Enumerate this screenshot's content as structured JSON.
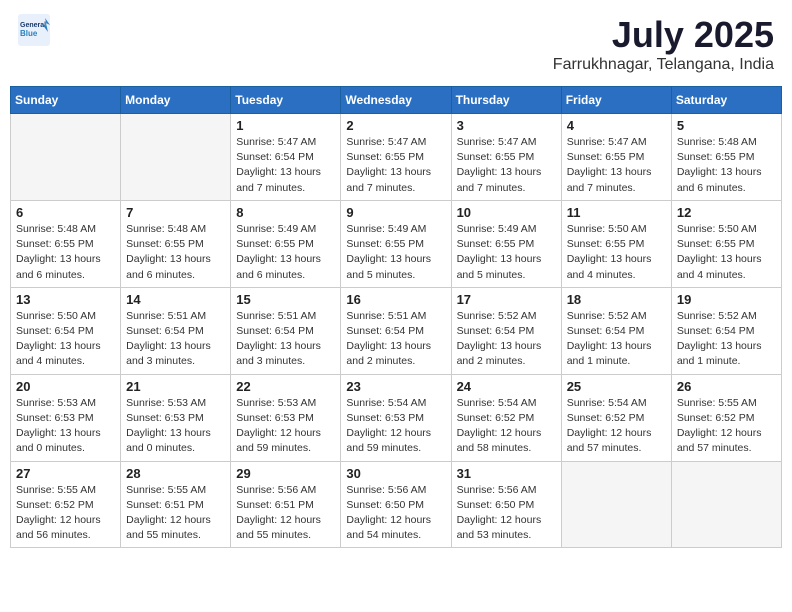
{
  "header": {
    "logo_line1": "General",
    "logo_line2": "Blue",
    "month_title": "July 2025",
    "subtitle": "Farrukhnagar, Telangana, India"
  },
  "weekdays": [
    "Sunday",
    "Monday",
    "Tuesday",
    "Wednesday",
    "Thursday",
    "Friday",
    "Saturday"
  ],
  "weeks": [
    [
      {
        "day": "",
        "info": ""
      },
      {
        "day": "",
        "info": ""
      },
      {
        "day": "1",
        "info": "Sunrise: 5:47 AM\nSunset: 6:54 PM\nDaylight: 13 hours\nand 7 minutes."
      },
      {
        "day": "2",
        "info": "Sunrise: 5:47 AM\nSunset: 6:55 PM\nDaylight: 13 hours\nand 7 minutes."
      },
      {
        "day": "3",
        "info": "Sunrise: 5:47 AM\nSunset: 6:55 PM\nDaylight: 13 hours\nand 7 minutes."
      },
      {
        "day": "4",
        "info": "Sunrise: 5:47 AM\nSunset: 6:55 PM\nDaylight: 13 hours\nand 7 minutes."
      },
      {
        "day": "5",
        "info": "Sunrise: 5:48 AM\nSunset: 6:55 PM\nDaylight: 13 hours\nand 6 minutes."
      }
    ],
    [
      {
        "day": "6",
        "info": "Sunrise: 5:48 AM\nSunset: 6:55 PM\nDaylight: 13 hours\nand 6 minutes."
      },
      {
        "day": "7",
        "info": "Sunrise: 5:48 AM\nSunset: 6:55 PM\nDaylight: 13 hours\nand 6 minutes."
      },
      {
        "day": "8",
        "info": "Sunrise: 5:49 AM\nSunset: 6:55 PM\nDaylight: 13 hours\nand 6 minutes."
      },
      {
        "day": "9",
        "info": "Sunrise: 5:49 AM\nSunset: 6:55 PM\nDaylight: 13 hours\nand 5 minutes."
      },
      {
        "day": "10",
        "info": "Sunrise: 5:49 AM\nSunset: 6:55 PM\nDaylight: 13 hours\nand 5 minutes."
      },
      {
        "day": "11",
        "info": "Sunrise: 5:50 AM\nSunset: 6:55 PM\nDaylight: 13 hours\nand 4 minutes."
      },
      {
        "day": "12",
        "info": "Sunrise: 5:50 AM\nSunset: 6:55 PM\nDaylight: 13 hours\nand 4 minutes."
      }
    ],
    [
      {
        "day": "13",
        "info": "Sunrise: 5:50 AM\nSunset: 6:54 PM\nDaylight: 13 hours\nand 4 minutes."
      },
      {
        "day": "14",
        "info": "Sunrise: 5:51 AM\nSunset: 6:54 PM\nDaylight: 13 hours\nand 3 minutes."
      },
      {
        "day": "15",
        "info": "Sunrise: 5:51 AM\nSunset: 6:54 PM\nDaylight: 13 hours\nand 3 minutes."
      },
      {
        "day": "16",
        "info": "Sunrise: 5:51 AM\nSunset: 6:54 PM\nDaylight: 13 hours\nand 2 minutes."
      },
      {
        "day": "17",
        "info": "Sunrise: 5:52 AM\nSunset: 6:54 PM\nDaylight: 13 hours\nand 2 minutes."
      },
      {
        "day": "18",
        "info": "Sunrise: 5:52 AM\nSunset: 6:54 PM\nDaylight: 13 hours\nand 1 minute."
      },
      {
        "day": "19",
        "info": "Sunrise: 5:52 AM\nSunset: 6:54 PM\nDaylight: 13 hours\nand 1 minute."
      }
    ],
    [
      {
        "day": "20",
        "info": "Sunrise: 5:53 AM\nSunset: 6:53 PM\nDaylight: 13 hours\nand 0 minutes."
      },
      {
        "day": "21",
        "info": "Sunrise: 5:53 AM\nSunset: 6:53 PM\nDaylight: 13 hours\nand 0 minutes."
      },
      {
        "day": "22",
        "info": "Sunrise: 5:53 AM\nSunset: 6:53 PM\nDaylight: 12 hours\nand 59 minutes."
      },
      {
        "day": "23",
        "info": "Sunrise: 5:54 AM\nSunset: 6:53 PM\nDaylight: 12 hours\nand 59 minutes."
      },
      {
        "day": "24",
        "info": "Sunrise: 5:54 AM\nSunset: 6:52 PM\nDaylight: 12 hours\nand 58 minutes."
      },
      {
        "day": "25",
        "info": "Sunrise: 5:54 AM\nSunset: 6:52 PM\nDaylight: 12 hours\nand 57 minutes."
      },
      {
        "day": "26",
        "info": "Sunrise: 5:55 AM\nSunset: 6:52 PM\nDaylight: 12 hours\nand 57 minutes."
      }
    ],
    [
      {
        "day": "27",
        "info": "Sunrise: 5:55 AM\nSunset: 6:52 PM\nDaylight: 12 hours\nand 56 minutes."
      },
      {
        "day": "28",
        "info": "Sunrise: 5:55 AM\nSunset: 6:51 PM\nDaylight: 12 hours\nand 55 minutes."
      },
      {
        "day": "29",
        "info": "Sunrise: 5:56 AM\nSunset: 6:51 PM\nDaylight: 12 hours\nand 55 minutes."
      },
      {
        "day": "30",
        "info": "Sunrise: 5:56 AM\nSunset: 6:50 PM\nDaylight: 12 hours\nand 54 minutes."
      },
      {
        "day": "31",
        "info": "Sunrise: 5:56 AM\nSunset: 6:50 PM\nDaylight: 12 hours\nand 53 minutes."
      },
      {
        "day": "",
        "info": ""
      },
      {
        "day": "",
        "info": ""
      }
    ]
  ]
}
